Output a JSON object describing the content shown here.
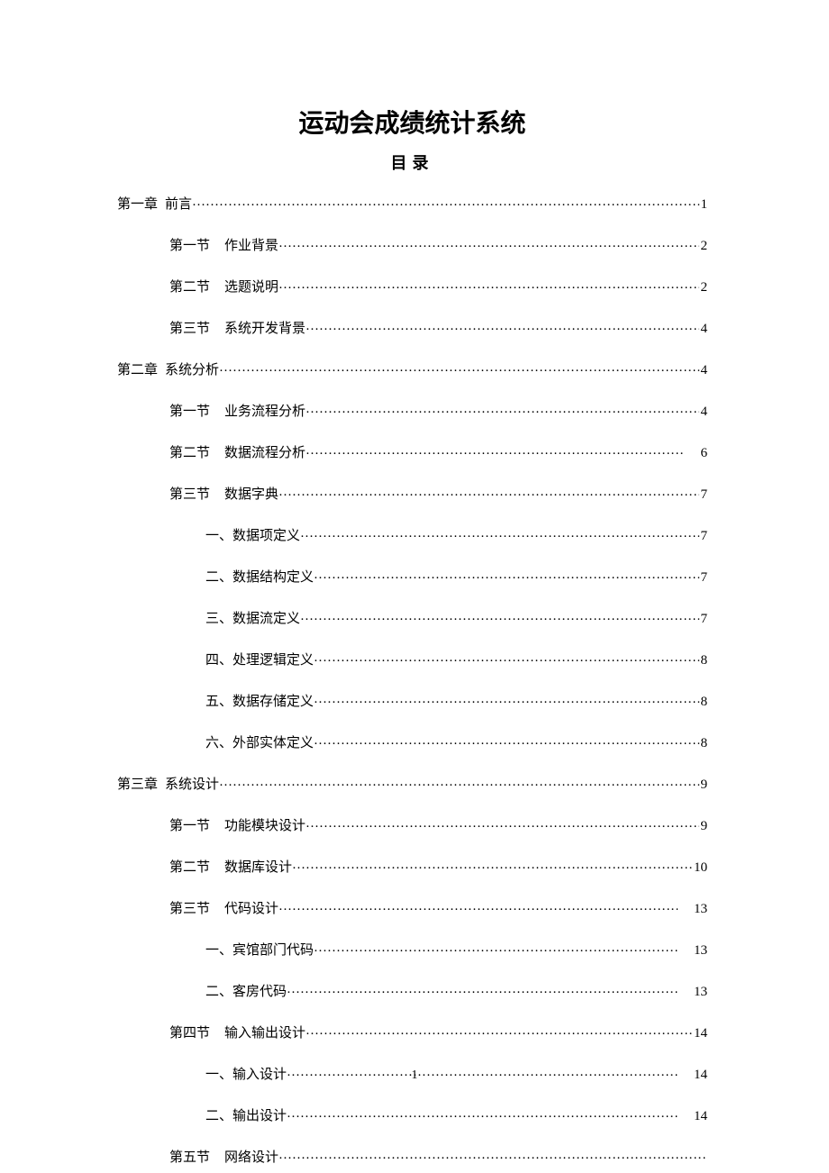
{
  "title": "运动会成绩统计系统",
  "subtitle": "目录",
  "page_number": "1",
  "toc": [
    {
      "indent": 0,
      "label": "第一章",
      "text": "前言",
      "page": "1",
      "sep": "narrow",
      "page_spaced": false
    },
    {
      "indent": 1,
      "label": "第一节",
      "text": "作业背景",
      "page": "2",
      "sep": "wide",
      "page_spaced": false
    },
    {
      "indent": 1,
      "label": "第二节",
      "text": "选题说明",
      "page": "2",
      "sep": "wide",
      "page_spaced": false
    },
    {
      "indent": 1,
      "label": "第三节",
      "text": "系统开发背景",
      "page": "4",
      "sep": "wide",
      "page_spaced": false
    },
    {
      "indent": 0,
      "label": "第二章",
      "text": "系统分析",
      "page": "4",
      "sep": "narrow",
      "page_spaced": false
    },
    {
      "indent": 1,
      "label": "第一节",
      "text": "业务流程分析",
      "page": "4",
      "sep": "wide",
      "page_spaced": false
    },
    {
      "indent": 1,
      "label": "第二节",
      "text": "数据流程分析",
      "page": "6",
      "sep": "wide",
      "page_spaced": true
    },
    {
      "indent": 1,
      "label": "第三节",
      "text": "数据字典",
      "page": "7",
      "sep": "wide",
      "page_spaced": false
    },
    {
      "indent": 2,
      "label": "一、",
      "text": "数据项定义",
      "page": "7",
      "sep": "none",
      "page_spaced": false
    },
    {
      "indent": 2,
      "label": "二、",
      "text": "数据结构定义",
      "page": "7",
      "sep": "none",
      "page_spaced": false
    },
    {
      "indent": 2,
      "label": "三、",
      "text": "数据流定义",
      "page": "7",
      "sep": "none",
      "page_spaced": false
    },
    {
      "indent": 2,
      "label": "四、",
      "text": "处理逻辑定义",
      "page": "8",
      "sep": "none",
      "page_spaced": false
    },
    {
      "indent": 2,
      "label": "五、",
      "text": "数据存储定义",
      "page": "8",
      "sep": "none",
      "page_spaced": false
    },
    {
      "indent": 2,
      "label": "六、",
      "text": "外部实体定义",
      "page": "8",
      "sep": "none",
      "page_spaced": false
    },
    {
      "indent": 0,
      "label": "第三章",
      "text": "系统设计",
      "page": "9",
      "sep": "narrow",
      "page_spaced": false
    },
    {
      "indent": 1,
      "label": "第一节",
      "text": "功能模块设计",
      "page": "9",
      "sep": "wide",
      "page_spaced": false
    },
    {
      "indent": 1,
      "label": "第二节",
      "text": "数据库设计",
      "page": "10",
      "sep": "wide",
      "page_spaced": false
    },
    {
      "indent": 1,
      "label": "第三节",
      "text": "代码设计",
      "page": "13",
      "sep": "wide",
      "page_spaced": true
    },
    {
      "indent": 2,
      "label": "一、",
      "text": "宾馆部门代码",
      "page": "13",
      "sep": "none",
      "page_spaced": true
    },
    {
      "indent": 2,
      "label": "二、",
      "text": "客房代码",
      "page": "13",
      "sep": "none",
      "page_spaced": true
    },
    {
      "indent": 1,
      "label": "第四节",
      "text": "输入输出设计",
      "page": "14",
      "sep": "wide",
      "page_spaced": false
    },
    {
      "indent": 2,
      "label": "一、",
      "text": "输入设计",
      "page": "14",
      "sep": "none",
      "page_spaced": true
    },
    {
      "indent": 2,
      "label": "二、",
      "text": "输出设计",
      "page": "14",
      "sep": "none",
      "page_spaced": true
    },
    {
      "indent": 1,
      "label": "第五节",
      "text": "网络设计",
      "page": "",
      "sep": "wide",
      "page_spaced": false
    }
  ]
}
